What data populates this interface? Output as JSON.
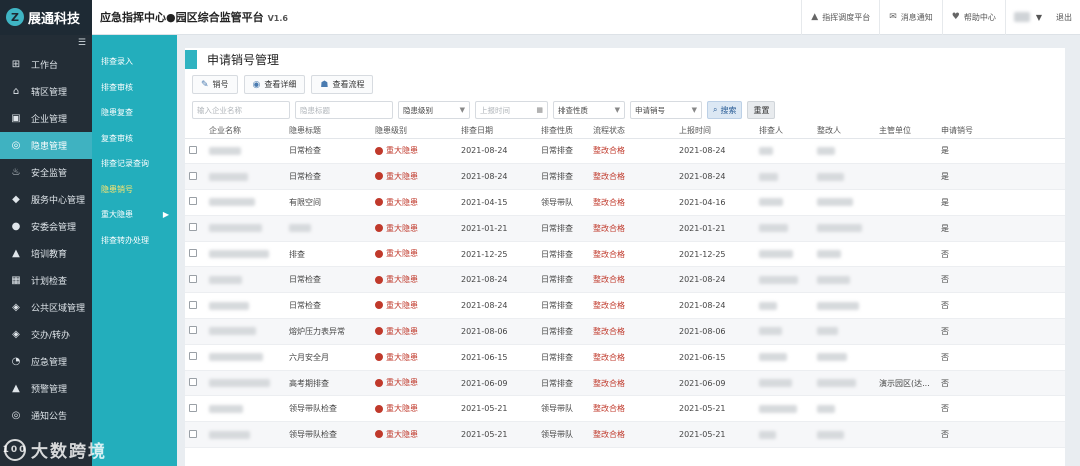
{
  "header": {
    "brand": "展通科技",
    "title": "应急指挥中心●园区综合监管平台",
    "version": "V1.6",
    "actions": [
      "指挥调度平台",
      "消息通知",
      "帮助中心"
    ],
    "logout": "退出"
  },
  "sidebar": {
    "items": [
      {
        "label": "工作台",
        "icon": "windows-icon"
      },
      {
        "label": "辖区管理",
        "icon": "home-icon"
      },
      {
        "label": "企业管理",
        "icon": "briefcase-icon"
      },
      {
        "label": "隐患管理",
        "icon": "wifi-icon"
      },
      {
        "label": "安全监管",
        "icon": "fire-icon"
      },
      {
        "label": "服务中心管理",
        "icon": "cube-icon"
      },
      {
        "label": "安委会管理",
        "icon": "user-icon"
      },
      {
        "label": "培训教育",
        "icon": "graduation-icon"
      },
      {
        "label": "计划检查",
        "icon": "calendar-icon"
      },
      {
        "label": "公共区域管理",
        "icon": "cubes-icon"
      },
      {
        "label": "交办/转办",
        "icon": "cubes-icon"
      },
      {
        "label": "应急管理",
        "icon": "bell-icon"
      },
      {
        "label": "预警管理",
        "icon": "warning-icon"
      },
      {
        "label": "通知公告",
        "icon": "broadcast-icon"
      }
    ],
    "active_index": 3
  },
  "subnav": {
    "items": [
      "排查录入",
      "排查审核",
      "隐患复查",
      "复查审核",
      "排查记录查询",
      "隐患销号",
      "重大隐患",
      "排查转办处理"
    ],
    "active_index": 5,
    "has_arrow_index": 6
  },
  "page": {
    "title": "申请销号管理",
    "buttons": [
      "销号",
      "查看详细",
      "查看流程"
    ],
    "filters": [
      {
        "placeholder": "输入企业名称",
        "type": "text"
      },
      {
        "placeholder": "隐患标题",
        "type": "text"
      },
      {
        "value": "隐患级别",
        "type": "select"
      },
      {
        "placeholder": "上报时间",
        "type": "date"
      },
      {
        "value": "排查性质",
        "type": "select"
      },
      {
        "value": "申请销号",
        "type": "select"
      }
    ],
    "search_label": "搜索",
    "reset_label": "重置"
  },
  "table": {
    "columns": [
      "企业名称",
      "隐患标题",
      "隐患级别",
      "排查日期",
      "排查性质",
      "流程状态",
      "上报时间",
      "排查人",
      "整改人",
      "主管单位",
      "申请销号"
    ],
    "rows": [
      {
        "title": "日常检查",
        "level": "重大隐患",
        "date": "2021-08-24",
        "nature": "日常排查",
        "status": "整改合格",
        "report": "2021-08-24",
        "unit": "",
        "apply": "是"
      },
      {
        "title": "日常检查",
        "level": "重大隐患",
        "date": "2021-08-24",
        "nature": "日常排查",
        "status": "整改合格",
        "report": "2021-08-24",
        "unit": "",
        "apply": "是"
      },
      {
        "title": "有限空间",
        "level": "重大隐患",
        "date": "2021-04-15",
        "nature": "领导带队",
        "status": "整改合格",
        "report": "2021-04-16",
        "unit": "",
        "apply": "是"
      },
      {
        "title": "",
        "level": "重大隐患",
        "date": "2021-01-21",
        "nature": "日常排查",
        "status": "整改合格",
        "report": "2021-01-21",
        "unit": "",
        "apply": "是"
      },
      {
        "title": "排查",
        "level": "重大隐患",
        "date": "2021-12-25",
        "nature": "日常排查",
        "status": "整改合格",
        "report": "2021-12-25",
        "unit": "",
        "apply": "否"
      },
      {
        "title": "日常检查",
        "level": "重大隐患",
        "date": "2021-08-24",
        "nature": "日常排查",
        "status": "整改合格",
        "report": "2021-08-24",
        "unit": "",
        "apply": "否"
      },
      {
        "title": "日常检查",
        "level": "重大隐患",
        "date": "2021-08-24",
        "nature": "日常排查",
        "status": "整改合格",
        "report": "2021-08-24",
        "unit": "",
        "apply": "否"
      },
      {
        "title": "熔炉压力表异常",
        "level": "重大隐患",
        "date": "2021-08-06",
        "nature": "日常排查",
        "status": "整改合格",
        "report": "2021-08-06",
        "unit": "",
        "apply": "否"
      },
      {
        "title": "六月安全月",
        "level": "重大隐患",
        "date": "2021-06-15",
        "nature": "日常排查",
        "status": "整改合格",
        "report": "2021-06-15",
        "unit": "",
        "apply": "否"
      },
      {
        "title": "高考期排查",
        "level": "重大隐患",
        "date": "2021-06-09",
        "nature": "日常排查",
        "status": "整改合格",
        "report": "2021-06-09",
        "unit": "演示园区(达...",
        "apply": "否"
      },
      {
        "title": "领导带队检查",
        "level": "重大隐患",
        "date": "2021-05-21",
        "nature": "领导带队",
        "status": "整改合格",
        "report": "2021-05-21",
        "unit": "",
        "apply": "否"
      },
      {
        "title": "领导带队检查",
        "level": "重大隐患",
        "date": "2021-05-21",
        "nature": "领导带队",
        "status": "整改合格",
        "report": "2021-05-21",
        "unit": "",
        "apply": "否"
      }
    ]
  },
  "watermark": {
    "logo": "100",
    "text": "大数跨境"
  },
  "colors": {
    "sidebar": "#232d36",
    "accent": "#3fb2c1",
    "subnav": "#23aebc",
    "danger": "#c0392b"
  }
}
